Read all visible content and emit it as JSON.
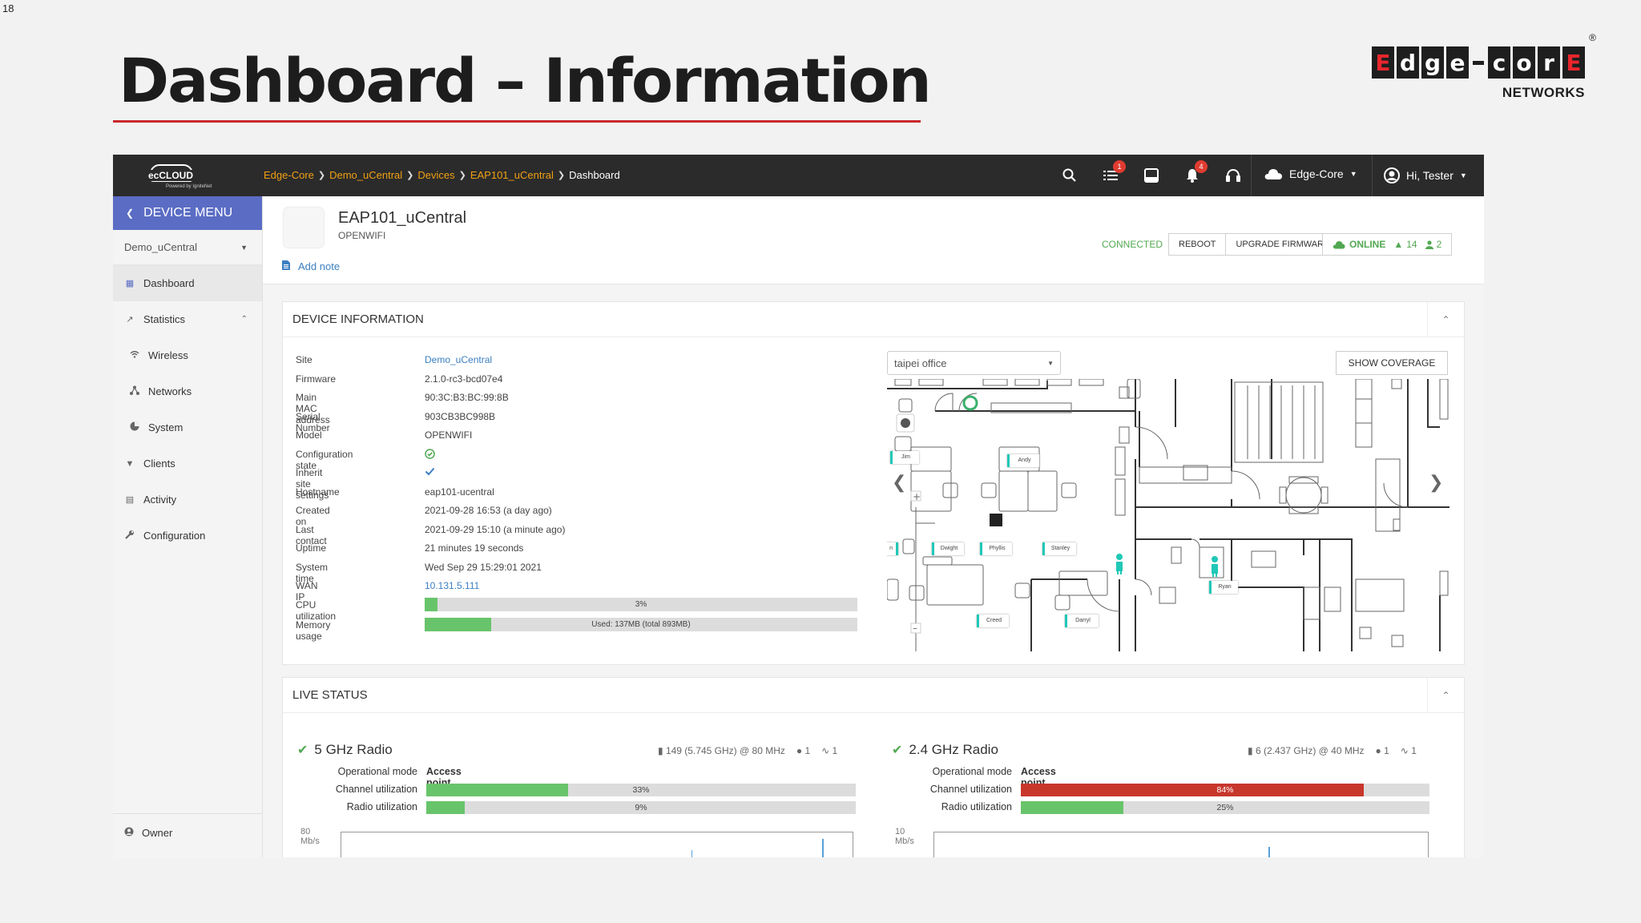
{
  "slide": {
    "number": "18",
    "title": "Dashboard – Information",
    "logo_letters": [
      "E",
      "d",
      "g",
      "e",
      "c",
      "o",
      "r",
      "E"
    ],
    "logo_sub": "NETWORKS",
    "logo_reg": "®"
  },
  "topbar": {
    "brand": "ecCLOUD",
    "brand_sub": "Powered by IgniteNet",
    "breadcrumbs": [
      "Edge-Core",
      "Demo_uCentral",
      "Devices",
      "EAP101_uCentral"
    ],
    "breadcrumb_current": "Dashboard",
    "tasks_badge": "1",
    "notifications_badge": "4",
    "org": "Edge-Core",
    "user": "Hi, Tester"
  },
  "sidebar": {
    "device_menu": "DEVICE MENU",
    "site_select": "Demo_uCentral",
    "items": [
      {
        "label": "Dashboard",
        "icon": "grid-icon"
      },
      {
        "label": "Statistics",
        "icon": "chart-icon"
      },
      {
        "label": "Wireless",
        "icon": "wifi-icon"
      },
      {
        "label": "Networks",
        "icon": "network-icon"
      },
      {
        "label": "System",
        "icon": "pie-icon"
      },
      {
        "label": "Clients",
        "icon": "filter-icon"
      },
      {
        "label": "Activity",
        "icon": "list-icon"
      },
      {
        "label": "Configuration",
        "icon": "wrench-icon"
      }
    ],
    "owner": "Owner"
  },
  "device": {
    "name": "EAP101_uCentral",
    "type": "OPENWIFI",
    "add_note": "Add note",
    "connected": "CONNECTED",
    "reboot": "REBOOT",
    "upgrade": "UPGRADE FIRMWARE",
    "online": "ONLINE",
    "alerts": "14",
    "clients": "2"
  },
  "device_info": {
    "title": "DEVICE INFORMATION",
    "rows": [
      {
        "label": "Site",
        "value": "Demo_uCentral"
      },
      {
        "label": "Firmware",
        "value": "2.1.0-rc3-bcd07e4"
      },
      {
        "label": "Main MAC address",
        "value": "90:3C:B3:BC:99:8B"
      },
      {
        "label": "Serial Number",
        "value": "903CB3BC998B"
      },
      {
        "label": "Model",
        "value": "OPENWIFI"
      },
      {
        "label": "Configuration state",
        "value": "✓"
      },
      {
        "label": "Inherit site settings",
        "value": "✓"
      },
      {
        "label": "Hostname",
        "value": "eap101-ucentral"
      },
      {
        "label": "Created on",
        "value": "2021-09-28 16:53 (a day ago)"
      },
      {
        "label": "Last contact",
        "value": "2021-09-29 15:10 (a minute ago)"
      },
      {
        "label": "Uptime",
        "value": "21 minutes 19 seconds"
      },
      {
        "label": "System time",
        "value": "Wed Sep 29 15:29:01 2021"
      },
      {
        "label": "WAN IP",
        "value": "10.131.5.111"
      }
    ],
    "cpu_label": "CPU utilization",
    "cpu_text": "3%",
    "cpu_pct": 3,
    "mem_label": "Memory usage",
    "mem_text": "Used: 137MB (total 893MB)",
    "mem_pct": 15.3,
    "floor_select": "taipei office",
    "show_coverage": "SHOW COVERAGE",
    "floor_labels": [
      "Jim",
      "Andy",
      "Dwight",
      "Phyllis",
      "Stanley",
      "Creed",
      "Darryl",
      "Ryan",
      "n"
    ]
  },
  "live_status": {
    "title": "LIVE STATUS",
    "radios": [
      {
        "name": "5 GHz Radio",
        "channel": "149 (5.745 GHz) @ 80 MHz",
        "clients": "1",
        "ssids": "1",
        "op_label": "Operational mode",
        "op_value": "Access point",
        "ch_label": "Channel utilization",
        "ch_text": "33%",
        "ch_pct": 33,
        "ch_color": "#68c46a",
        "ru_label": "Radio utilization",
        "ru_text": "9%",
        "ru_pct": 9,
        "ru_color": "#68c46a",
        "chart_label": "80 Mb/s"
      },
      {
        "name": "2.4 GHz Radio",
        "channel": "6 (2.437 GHz) @ 40 MHz",
        "clients": "1",
        "ssids": "1",
        "op_label": "Operational mode",
        "op_value": "Access point",
        "ch_label": "Channel utilization",
        "ch_text": "84%",
        "ch_pct": 84,
        "ch_color": "#c7372c",
        "ru_label": "Radio utilization",
        "ru_text": "25%",
        "ru_pct": 25,
        "ru_color": "#68c46a",
        "chart_label": "10 Mb/s"
      }
    ]
  }
}
